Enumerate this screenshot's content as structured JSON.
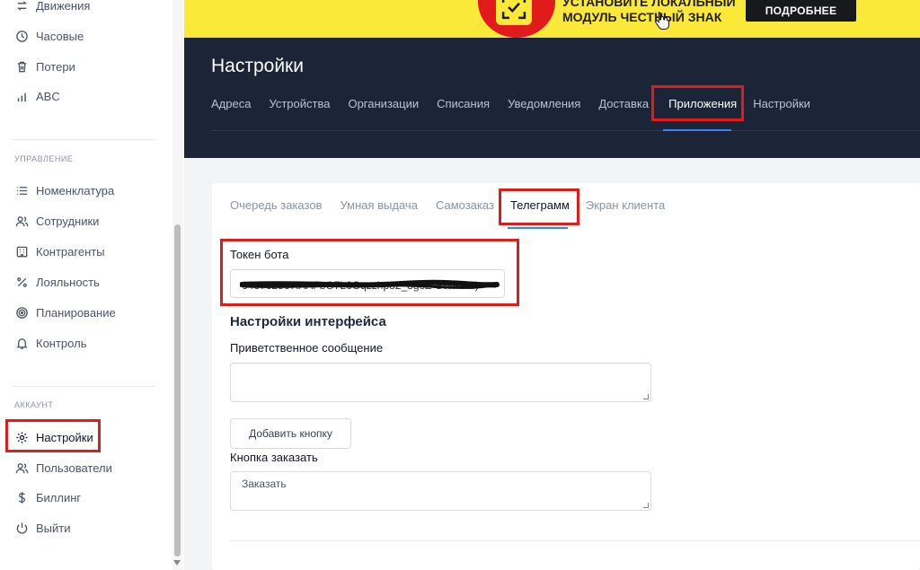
{
  "sidebar": {
    "top_items": [
      {
        "label": "Движения",
        "icon": "transfer-icon"
      },
      {
        "label": "Часовые",
        "icon": "clock-icon"
      },
      {
        "label": "Потери",
        "icon": "trash-icon"
      },
      {
        "label": "ABC",
        "icon": "bar-chart-icon"
      }
    ],
    "management_label": "УПРАВЛЕНИЕ",
    "management_items": [
      {
        "label": "Номенклатура",
        "icon": "list-icon"
      },
      {
        "label": "Сотрудники",
        "icon": "users-icon"
      },
      {
        "label": "Контрагенты",
        "icon": "building-icon"
      },
      {
        "label": "Лояльность",
        "icon": "percent-icon"
      },
      {
        "label": "Планирование",
        "icon": "target-icon"
      },
      {
        "label": "Контроль",
        "icon": "bell-icon"
      }
    ],
    "account_label": "АККАУНТ",
    "account_items": [
      {
        "label": "Настройки",
        "icon": "gear-icon"
      },
      {
        "label": "Пользователи",
        "icon": "users-icon"
      },
      {
        "label": "Биллинг",
        "icon": "dollar-icon"
      },
      {
        "label": "Выйти",
        "icon": "power-icon"
      }
    ]
  },
  "banner": {
    "line1": "УСТАНОВИТЕ ЛОКАЛЬНЫЙ",
    "line2": "МОДУЛЬ ЧЕСТНЫЙ ЗНАК",
    "button": "ПОДРОБНЕЕ"
  },
  "header": {
    "title": "Настройки",
    "tabs": [
      "Адреса",
      "Устройства",
      "Организации",
      "Списания",
      "Уведомления",
      "Доставка",
      "Приложения",
      "Настройки"
    ],
    "active_tab": "Приложения"
  },
  "subtabs": {
    "items": [
      "Очередь заказов",
      "Умная выдача",
      "Самозаказ",
      "Телеграмм",
      "Экран клиента"
    ],
    "active": "Телеграмм"
  },
  "form": {
    "token_label": "Токен бота",
    "token_value": "646762867:AAFbG7L6Gqzzhp82_8g8Z-SWAWo)",
    "interface_title": "Настройки интерфейса",
    "welcome_label": "Приветственное сообщение",
    "welcome_value": "",
    "add_button": "Добавить кнопку",
    "order_label": "Кнопка заказать",
    "order_value": "Заказать"
  },
  "colors": {
    "highlight": "#e11b1b",
    "banner_bg": "#fbe93a",
    "header_bg": "#1b2537",
    "accent": "#3b82f6"
  }
}
